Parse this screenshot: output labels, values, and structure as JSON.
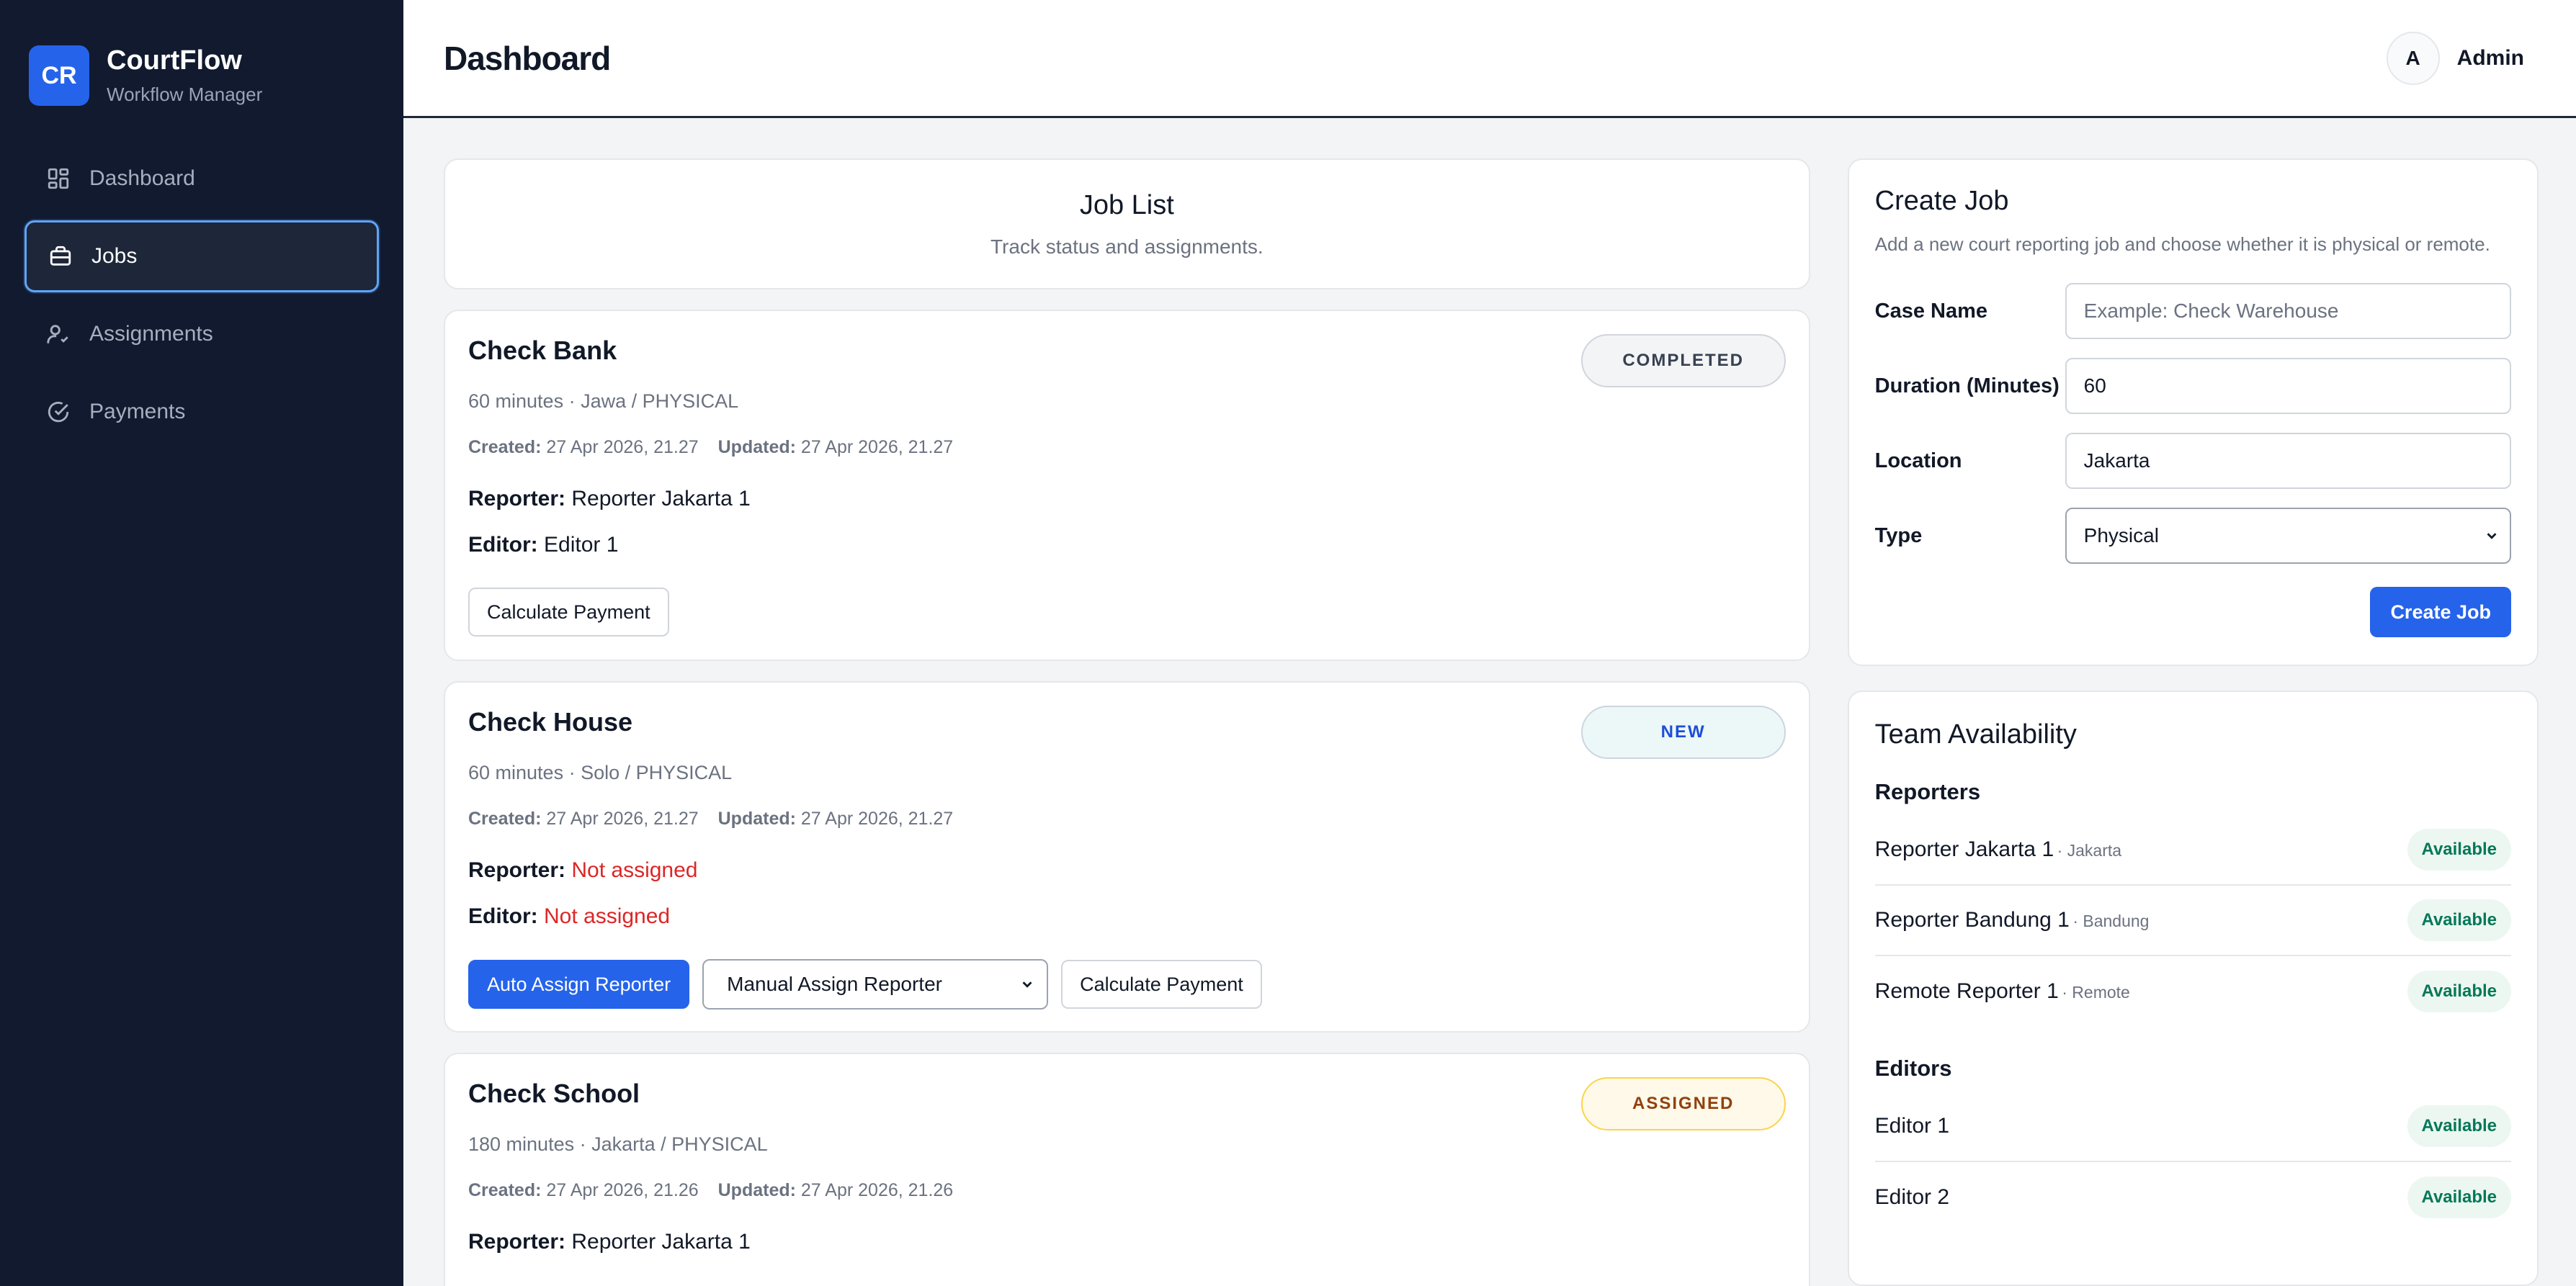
{
  "brand": {
    "logo": "CR",
    "name": "CourtFlow",
    "subtitle": "Workflow Manager"
  },
  "sidebar": {
    "items": [
      {
        "label": "Dashboard",
        "icon": "dashboard-grid-icon",
        "active": false
      },
      {
        "label": "Jobs",
        "icon": "briefcase-icon",
        "active": true
      },
      {
        "label": "Assignments",
        "icon": "user-check-icon",
        "active": false
      },
      {
        "label": "Payments",
        "icon": "check-circle-icon",
        "active": false
      }
    ]
  },
  "header": {
    "title": "Dashboard",
    "avatar": "A",
    "user": "Admin"
  },
  "job_list": {
    "title": "Job List",
    "subtitle": "Track status and assignments."
  },
  "labels": {
    "created": "Created:",
    "updated": "Updated:",
    "reporter": "Reporter:",
    "editor": "Editor:"
  },
  "jobs": [
    {
      "title": "Check Bank",
      "status": "COMPLETED",
      "meta": "60 minutes · Jawa / PHYSICAL",
      "created": "27 Apr 2026, 21.27",
      "updated": "27 Apr 2026, 21.27",
      "reporter": "Reporter Jakarta 1",
      "editor": "Editor 1",
      "calc_label": "Calculate Payment"
    },
    {
      "title": "Check House",
      "status": "NEW",
      "meta": "60 minutes · Solo / PHYSICAL",
      "created": "27 Apr 2026, 21.27",
      "updated": "27 Apr 2026, 21.27",
      "reporter": "Not assigned",
      "editor": "Not assigned",
      "auto_label": "Auto Assign Reporter",
      "manual_label": "Manual Assign Reporter",
      "calc_label": "Calculate Payment"
    },
    {
      "title": "Check School",
      "status": "ASSIGNED",
      "meta": "180 minutes · Jakarta / PHYSICAL",
      "created": "27 Apr 2026, 21.26",
      "updated": "27 Apr 2026, 21.26",
      "reporter": "Reporter Jakarta 1"
    }
  ],
  "create_job": {
    "title": "Create Job",
    "subtitle": "Add a new court reporting job and choose whether it is physical or remote.",
    "case_name_label": "Case Name",
    "case_name_placeholder": "Example: Check Warehouse",
    "duration_label": "Duration (Minutes)",
    "duration_value": "60",
    "location_label": "Location",
    "location_value": "Jakarta",
    "type_label": "Type",
    "type_value": "Physical",
    "submit_label": "Create Job"
  },
  "team": {
    "title": "Team Availability",
    "reporters_label": "Reporters",
    "reporters": [
      {
        "name": "Reporter Jakarta 1",
        "location": "· Jakarta",
        "status": "Available"
      },
      {
        "name": "Reporter Bandung 1",
        "location": "· Bandung",
        "status": "Available"
      },
      {
        "name": "Remote Reporter 1",
        "location": "· Remote",
        "status": "Available"
      }
    ],
    "editors_label": "Editors",
    "editors": [
      {
        "name": "Editor 1",
        "status": "Available"
      },
      {
        "name": "Editor 2",
        "status": "Available"
      }
    ]
  },
  "colors": {
    "sidebar_bg": "#111a2e",
    "accent": "#2563eb",
    "danger": "#dc2626",
    "available": "#047857"
  }
}
